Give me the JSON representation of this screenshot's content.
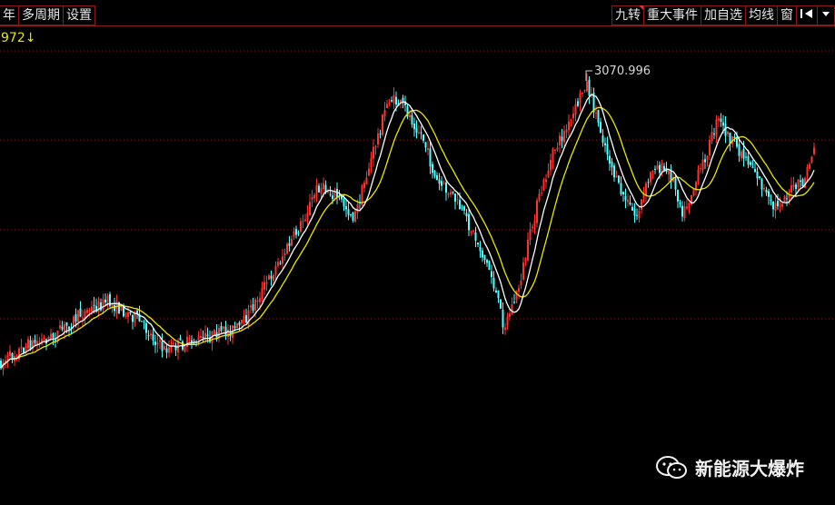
{
  "toolbar": {
    "left": [
      "年",
      "多周期",
      "设置"
    ],
    "right": [
      {
        "label": "九转",
        "marked": true
      },
      {
        "label": "重大事件",
        "marked": false
      },
      {
        "label": "加自选",
        "marked": false
      },
      {
        "label": "均线",
        "marked": false
      },
      {
        "label": "窗",
        "marked": false
      }
    ],
    "icons": [
      "collapse-panel-icon",
      "dropdown-arrow-icon"
    ]
  },
  "price": {
    "top_value": "972",
    "top_value_arrow": "↓",
    "peak_label": "3070.996"
  },
  "watermark": {
    "text": "新能源大爆炸",
    "icon": "wechat-icon"
  },
  "colors": {
    "background": "#000000",
    "up_candle": "#ff3232",
    "down_candle": "#54ffff",
    "ma_short": "#ffffff",
    "ma_long": "#e8e800",
    "grid": "#8a1a1a",
    "border": "#8a1a1a"
  }
}
